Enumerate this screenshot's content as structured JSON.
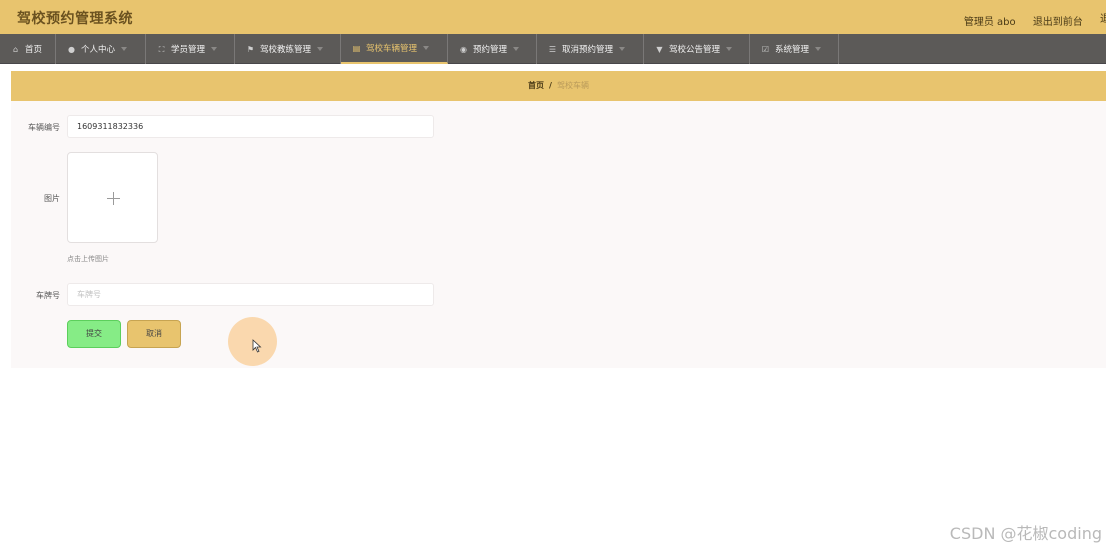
{
  "app": {
    "title": "驾校预约管理系统",
    "user_label": "管理员 abo",
    "exit_label": "退出到前台",
    "cut_label": "退"
  },
  "nav": [
    {
      "label": "首页",
      "icon": "home-icon"
    },
    {
      "label": "个人中心",
      "icon": "user-icon"
    },
    {
      "label": "学员管理",
      "icon": "frame-icon"
    },
    {
      "label": "驾校教练管理",
      "icon": "flag-icon"
    },
    {
      "label": "驾校车辆管理",
      "icon": "clipboard-icon",
      "active": true
    },
    {
      "label": "预约管理",
      "icon": "location-icon"
    },
    {
      "label": "取消预约管理",
      "icon": "sliders-icon"
    },
    {
      "label": "驾校公告管理",
      "icon": "trophy-icon"
    },
    {
      "label": "系统管理",
      "icon": "checkbox-icon"
    }
  ],
  "breadcrumb": {
    "home": "首页",
    "separator": "/",
    "current": "驾校车辆"
  },
  "form": {
    "vehicle_no_label": "车辆编号",
    "vehicle_no_value": "1609311832336",
    "image_label": "图片",
    "upload_hint": "点击上传图片",
    "plate_label": "车牌号",
    "plate_placeholder": "车牌号",
    "submit_label": "提交",
    "cancel_label": "取消"
  },
  "watermark": "CSDN @花椒coding",
  "colors": {
    "accent": "#e8c46e",
    "nav_bg": "#5c5a58",
    "submit_green": "#86ec86"
  }
}
